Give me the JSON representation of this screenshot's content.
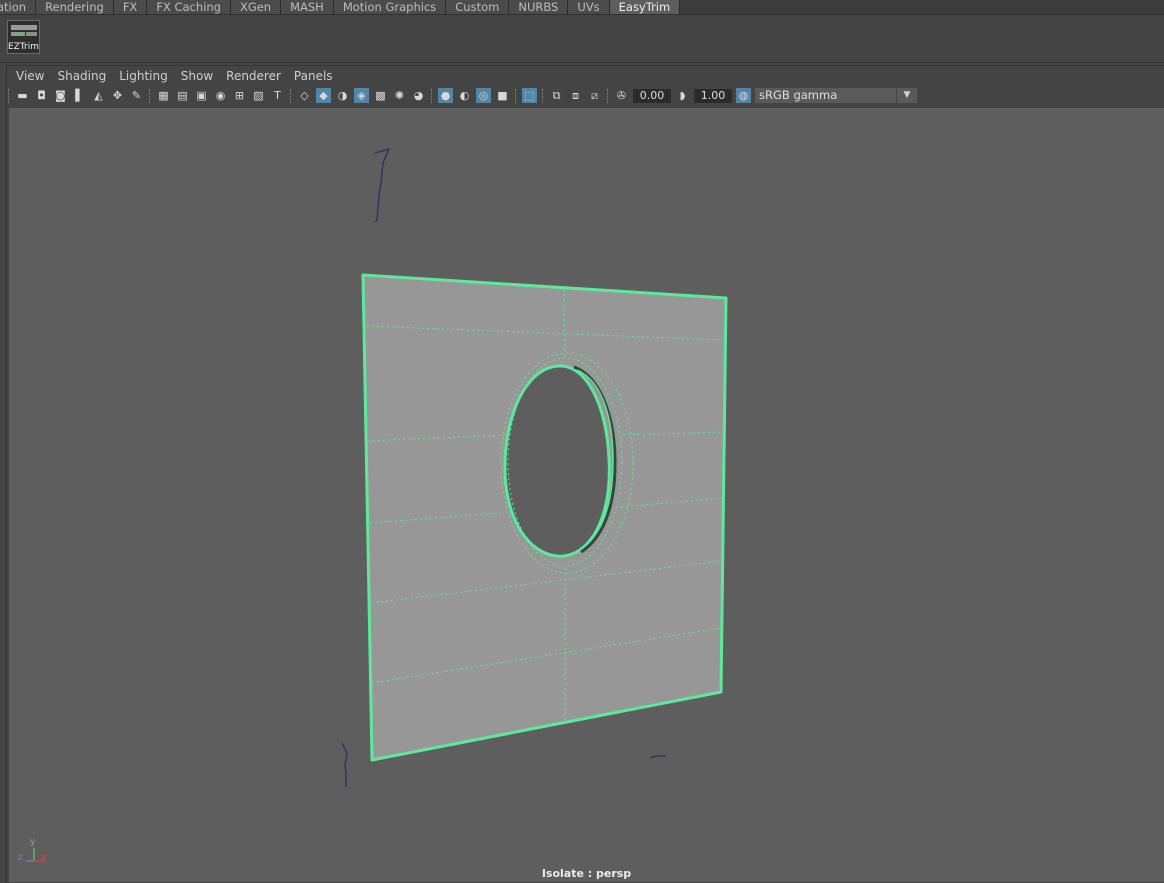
{
  "shelf_tabs": [
    {
      "label": "ation",
      "active": false
    },
    {
      "label": "Rendering",
      "active": false
    },
    {
      "label": "FX",
      "active": false
    },
    {
      "label": "FX Caching",
      "active": false
    },
    {
      "label": "XGen",
      "active": false
    },
    {
      "label": "MASH",
      "active": false
    },
    {
      "label": "Motion Graphics",
      "active": false
    },
    {
      "label": "Custom",
      "active": false
    },
    {
      "label": "NURBS",
      "active": false
    },
    {
      "label": "UVs",
      "active": false
    },
    {
      "label": "EasyTrim",
      "active": true
    }
  ],
  "shelf": {
    "eztrim_label": "EZTrim"
  },
  "panel_menu": [
    "View",
    "Shading",
    "Lighting",
    "Show",
    "Renderer",
    "Panels"
  ],
  "toolbar": {
    "exposure_value": "0.00",
    "gamma_value": "1.00",
    "color_space": "sRGB gamma"
  },
  "viewport": {
    "hud_label": "Isolate : persp",
    "axis_labels": {
      "x": "x",
      "y": "y",
      "z": "z"
    },
    "colors": {
      "background": "#5e5e5e",
      "plane_fill": "#979797",
      "selection_outline": "#5ee89c",
      "axis_x": "#d8443a",
      "axis_y": "#62c06a",
      "axis_z": "#4a8fe0",
      "curve": "#2d2d6e"
    }
  }
}
